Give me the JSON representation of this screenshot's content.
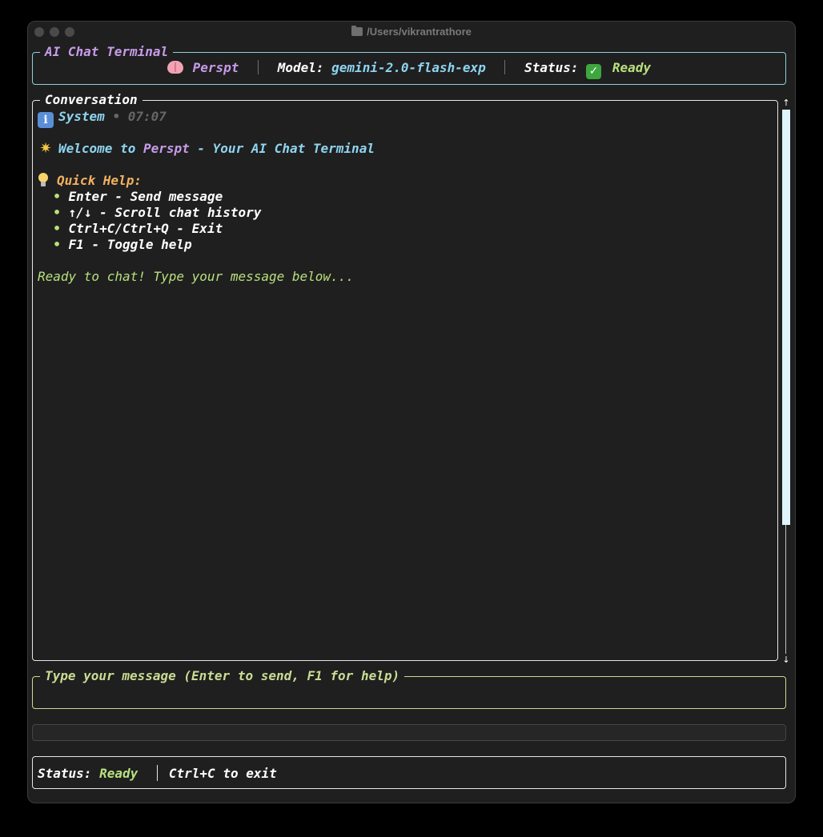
{
  "window": {
    "title": "/Users/vikrantrathore"
  },
  "header": {
    "box_title": "AI Chat Terminal",
    "app_name": "Perspt",
    "model_label": "Model:",
    "model_value": "gemini-2.0-flash-exp",
    "status_label": "Status:",
    "status_value": "Ready"
  },
  "conversation": {
    "box_title": "Conversation",
    "message": {
      "sender": "System",
      "time": "• 07:07",
      "welcome_prefix": "Welcome to ",
      "welcome_app": "Perspt",
      "welcome_suffix": " - Your AI Chat Terminal",
      "quick_help_title": "Quick Help:",
      "help_items": [
        "Enter - Send message",
        "↑/↓ - Scroll chat history",
        "Ctrl+C/Ctrl+Q - Exit",
        "F1 - Toggle help"
      ],
      "ready_text": "Ready to chat! Type your message below..."
    }
  },
  "input": {
    "box_title": "Type your message (Enter to send, F1 for help)",
    "value": ""
  },
  "statusbar": {
    "status_label": "Status:",
    "status_value": "Ready",
    "hint": "Ctrl+C to exit"
  },
  "icons": {
    "app_icon": "brain-icon",
    "status_icon": "check-icon",
    "system_icon": "info-icon",
    "welcome_icon": "star-icon",
    "help_icon": "lightbulb-icon",
    "title_icon": "folder-icon"
  },
  "colors": {
    "header_border": "#8fd0dc",
    "input_border": "#c9dc93",
    "accent_purple": "#c79bea",
    "accent_cyan": "#8ed4f0",
    "accent_green": "#b7e07d",
    "accent_orange": "#f3b15f"
  }
}
